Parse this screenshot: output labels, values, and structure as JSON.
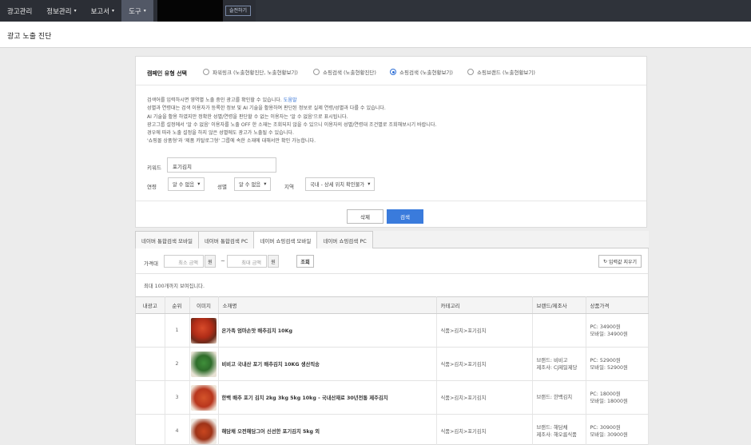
{
  "nav": {
    "items": [
      {
        "label": "광고관리",
        "caret": false
      },
      {
        "label": "정보관리",
        "caret": true
      },
      {
        "label": "보고서",
        "caret": true
      },
      {
        "label": "도구",
        "caret": true
      }
    ],
    "caret_glyph": "▾",
    "switch_label": "슬전하기"
  },
  "page": {
    "title": "광고 노출 진단"
  },
  "campaign": {
    "label": "캠페인 유형 선택",
    "options": [
      "파워링크 (노출현황진단, 노출현황보기)",
      "쇼핑검색 (노출현황진단)",
      "쇼핑검색 (노출현황보기)",
      "쇼핑브랜드 (노출현황보기)"
    ],
    "selected_index": 2
  },
  "description": {
    "line1": "검색어를 입력하시면 영역별 노출 중인 광고를 확인할 수 있습니다.",
    "help_link": "도움말",
    "line2": "성별과 연령대는 검색 이용자가 등록한 정보 및 AI 기술을 활용하여 판단된 정보로 실제 연령/성별과 다를 수 있습니다.",
    "line3": "AI 기술을 활용 하였지만 정확한 성별/연령을 판단할 수 없는 이용자는 '알 수 없음'으로 표시됩니다.",
    "line4": "광고그룹 설정에서 '알 수 없음' 이용자를 노출 OFF 한 소재는 조회되지 않을 수 있으니 이용자의 성별/연령대 조건별로 조회해보시기 바랍니다.",
    "line5": "경우에 따라 노출 설정을 하지 않은 성별에도 광고가 노출될 수 있습니다.",
    "line6": "'쇼핑몰 상품형'과 '제품 카탈로그형' 그룹에 속한 소재에 대해서만 확인 가능합니다."
  },
  "form": {
    "keyword_label": "키워드",
    "keyword_value": "포기김치",
    "age_label": "연령",
    "age_value": "알 수 없음",
    "gender_label": "성별",
    "gender_value": "알 수 없음",
    "region_label": "지역",
    "region_value": "국내 - 상세 위치 확인불가",
    "reset_label": "삭제",
    "search_label": "검색"
  },
  "tabs": [
    "네이버 통합검색 모바일",
    "네이버 통합검색 PC",
    "네이버 쇼핑검색 모바일",
    "네이버 쇼핑검색 PC"
  ],
  "active_tab": 2,
  "filter": {
    "price_label": "가격대",
    "min_placeholder": "최소 금액",
    "max_placeholder": "최대 금액",
    "unit": "원",
    "tilde": "~",
    "query_label": "조회",
    "clear_label": "입력값 지우기",
    "max_note": "최대 100개까지 보여집니다."
  },
  "table": {
    "headers": [
      "내광고",
      "순위",
      "이미지",
      "소재명",
      "카테고리",
      "브랜드/제조사",
      "상품가격"
    ],
    "rows": [
      {
        "rank": "1",
        "name": "온가족 엄마손맛 배추김치 10Kg",
        "category": "식품>김치>포기김치",
        "brand1": "",
        "brand2": "",
        "price1": "PC: 34900원",
        "price2": "모바일: 34900원"
      },
      {
        "rank": "2",
        "name": "비비고 국내산 포기 배추김치 10KG 생산직송",
        "category": "식품>김치>포기김치",
        "brand1": "브랜드: 비비고",
        "brand2": "제조사: CJ제일제당",
        "price1": "PC: 52900원",
        "price2": "모바일: 52900원"
      },
      {
        "rank": "3",
        "name": "한백 배추 포기 김치 2kg 3kg 5kg 10kg - 국내산재료 30년전통 제주김치",
        "category": "식품>김치>포기김치",
        "brand1": "브랜드: 한백김치",
        "brand2": "",
        "price1": "PC: 18000원",
        "price2": "모바일: 18000원"
      },
      {
        "rank": "4",
        "name": "해담채 오전해담그어 신선한 포기김치 5kg 외",
        "category": "식품>김치>포기김치",
        "brand1": "브랜드: 해담채",
        "brand2": "제조사: 해오름식품",
        "price1": "PC: 30900원",
        "price2": "모바일: 30900원"
      }
    ]
  },
  "colors": {
    "nav_bg": "#2b2e35",
    "accent": "#3a7bdc",
    "link": "#2f6fd6"
  }
}
